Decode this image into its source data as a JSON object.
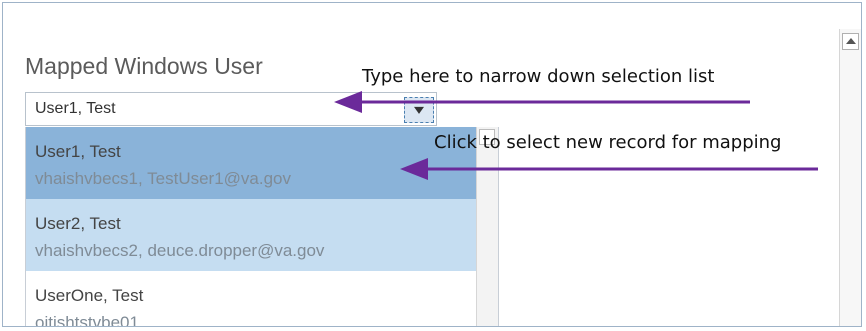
{
  "field": {
    "label": "Mapped Windows User",
    "value": "User1, Test"
  },
  "dropdown": {
    "items": [
      {
        "name": "User1, Test",
        "detail": "vhaishvbecs1, TestUser1@va.gov",
        "state": "selected"
      },
      {
        "name": "User2, Test",
        "detail": "vhaishvbecs2, deuce.dropper@va.gov",
        "state": "hover"
      },
      {
        "name": "UserOne, Test",
        "detail": "oitishtstvbe01",
        "state": "normal"
      }
    ]
  },
  "annotations": {
    "type_hint": "Type here to narrow down selection list",
    "click_hint": "Click to select new record for mapping"
  },
  "colors": {
    "selected_row": "#8ab3d9",
    "hover_row": "#c5ddf1",
    "annotation_arrow": "#6b2a9a"
  },
  "icons": {
    "dropdown_button": "chevron-down-icon",
    "scroll_up": "scroll-up-icon"
  }
}
